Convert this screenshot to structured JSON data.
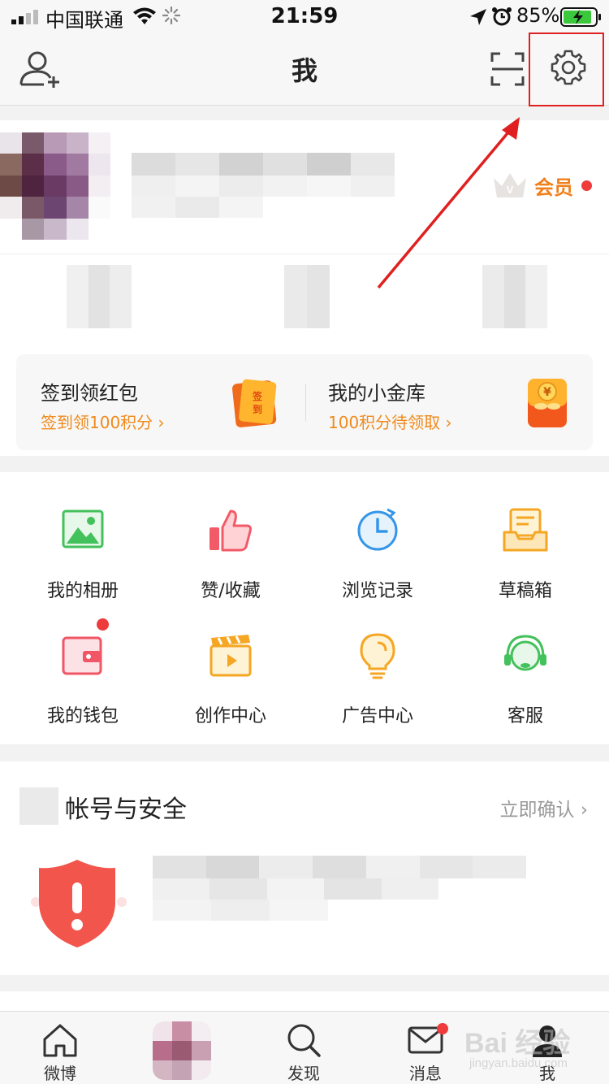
{
  "status_bar": {
    "carrier": "中国联通",
    "time": "21:59",
    "battery": "85%"
  },
  "nav": {
    "title": "我"
  },
  "profile": {
    "vip_label": "会员"
  },
  "rewards": {
    "checkin_title": "签到领红包",
    "checkin_sub": "签到领100积分 ›",
    "checkin_icon_text": "签到",
    "vault_title": "我的小金库",
    "vault_sub": "100积分待领取 ›",
    "vault_icon_text": "¥"
  },
  "grid": {
    "items": [
      {
        "label": "我的相册",
        "icon": "photo-album-icon"
      },
      {
        "label": "赞/收藏",
        "icon": "thumbs-up-icon"
      },
      {
        "label": "浏览记录",
        "icon": "clock-history-icon"
      },
      {
        "label": "草稿箱",
        "icon": "drafts-inbox-icon"
      },
      {
        "label": "我的钱包",
        "icon": "wallet-icon"
      },
      {
        "label": "创作中心",
        "icon": "clapperboard-icon"
      },
      {
        "label": "广告中心",
        "icon": "lightbulb-icon"
      },
      {
        "label": "客服",
        "icon": "headset-icon"
      }
    ]
  },
  "security": {
    "title": "帐号与安全",
    "link": "立即确认 ›"
  },
  "tabbar": {
    "items": [
      {
        "label": "微博",
        "icon": "home-icon"
      },
      {
        "label": "",
        "icon": "avatar"
      },
      {
        "label": "发现",
        "icon": "search-icon"
      },
      {
        "label": "消息",
        "icon": "mail-icon"
      },
      {
        "label": "我",
        "icon": "user-icon"
      }
    ]
  },
  "watermark": {
    "text": "Bai 经验",
    "sub": "jingyan.baidu.com"
  },
  "colors": {
    "accent_orange": "#f08a1c",
    "badge_red": "#ee3b3b",
    "highlight_red": "#e02020"
  }
}
